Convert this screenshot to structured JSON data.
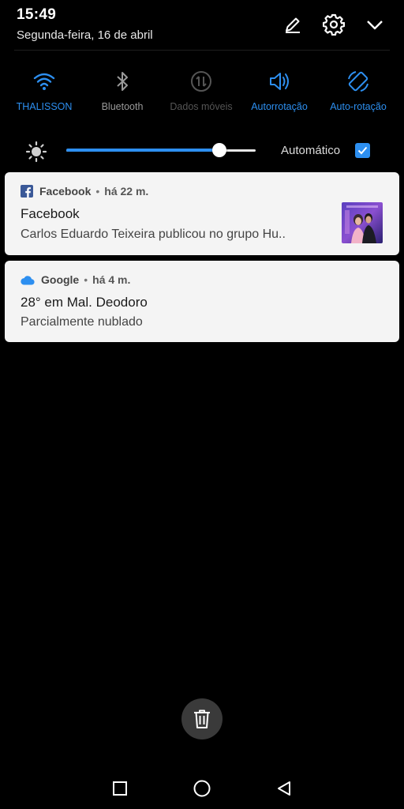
{
  "status": {
    "time": "15:49",
    "date": "Segunda-feira, 16 de abril"
  },
  "header_icons": [
    "edit-icon",
    "settings-icon",
    "chevron-down-icon"
  ],
  "toggles": [
    {
      "label": "THALISSON",
      "icon": "wifi-icon",
      "state": "on"
    },
    {
      "label": "Bluetooth",
      "icon": "bluetooth-icon",
      "state": "off"
    },
    {
      "label": "Dados móveis",
      "icon": "mobile-data-icon",
      "state": "disabled"
    },
    {
      "label": "Autorrotação",
      "icon": "volume-icon",
      "state": "on"
    },
    {
      "label": "Auto-rotação",
      "icon": "auto-rotate-icon",
      "state": "on"
    }
  ],
  "brightness": {
    "level": 0.81,
    "auto_label": "Automático",
    "auto_checked": true
  },
  "notifications": [
    {
      "app": "Facebook",
      "ago": "há 22 m.",
      "title": "Facebook",
      "body": "Carlos Eduardo Teixeira publicou no grupo Hu..",
      "icon": "facebook-icon",
      "has_thumbnail": true
    },
    {
      "app": "Google",
      "ago": "há 4 m.",
      "title": "28° em Mal. Deodoro",
      "body": "Parcialmente nublado",
      "icon": "cloud-icon",
      "has_thumbnail": false
    }
  ],
  "clear_button": {
    "icon": "trash-icon"
  },
  "nav": [
    "recents-icon",
    "home-icon",
    "back-icon"
  ],
  "colors": {
    "accent": "#2d8ff0",
    "background": "#000000",
    "card": "#f4f4f4",
    "facebook": "#3b5998"
  },
  "separator": "•"
}
